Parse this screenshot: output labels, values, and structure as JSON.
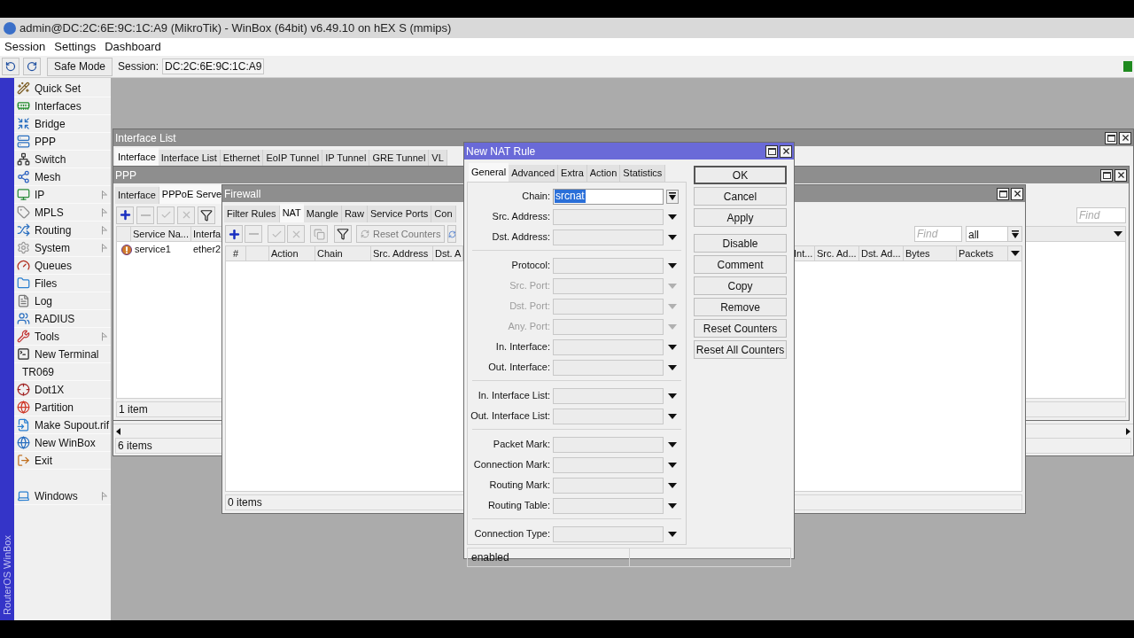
{
  "app": {
    "title": "admin@DC:2C:6E:9C:1C:A9 (MikroTik) - WinBox (64bit) v6.49.10 on hEX S (mmips)",
    "menu": [
      "Session",
      "Settings",
      "Dashboard"
    ],
    "safe_mode": "Safe Mode",
    "session_label": "Session:",
    "session_value": "DC:2C:6E:9C:1C:A9",
    "side_label": "RouterOS WinBox"
  },
  "sidebar": {
    "groups": [
      [
        {
          "label": "Quick Set",
          "submenu": false
        },
        {
          "label": "Interfaces",
          "submenu": false
        },
        {
          "label": "Bridge",
          "submenu": false
        },
        {
          "label": "PPP",
          "submenu": false
        },
        {
          "label": "Switch",
          "submenu": false
        },
        {
          "label": "Mesh",
          "submenu": false
        },
        {
          "label": "IP",
          "submenu": true
        },
        {
          "label": "MPLS",
          "submenu": true
        },
        {
          "label": "Routing",
          "submenu": true
        },
        {
          "label": "System",
          "submenu": true
        },
        {
          "label": "Queues",
          "submenu": false
        },
        {
          "label": "Files",
          "submenu": false
        },
        {
          "label": "Log",
          "submenu": false
        },
        {
          "label": "RADIUS",
          "submenu": false
        },
        {
          "label": "Tools",
          "submenu": true
        },
        {
          "label": "New Terminal",
          "submenu": false
        },
        {
          "label": "TR069",
          "submenu": false
        },
        {
          "label": "Dot1X",
          "submenu": false
        },
        {
          "label": "Partition",
          "submenu": false
        },
        {
          "label": "Make Supout.rif",
          "submenu": false
        },
        {
          "label": "New WinBox",
          "submenu": false
        },
        {
          "label": "Exit",
          "submenu": false
        }
      ],
      [
        {
          "label": "Windows",
          "submenu": true
        }
      ]
    ]
  },
  "interface_list_window": {
    "title": "Interface List",
    "tabs": [
      {
        "label": "Interface",
        "selected": true
      },
      {
        "label": "Interface List",
        "selected": false
      },
      {
        "label": "Ethernet",
        "selected": false
      },
      {
        "label": "EoIP Tunnel",
        "selected": false
      },
      {
        "label": "IP Tunnel",
        "selected": false
      },
      {
        "label": "GRE Tunnel",
        "selected": false
      },
      {
        "label": "VL",
        "selected": false
      }
    ],
    "status": "6 items"
  },
  "ppp_window": {
    "title": "PPP",
    "tabs": [
      {
        "label": "Interface",
        "selected": false
      },
      {
        "label": "PPPoE Serve",
        "selected": true
      }
    ],
    "find_placeholder": "Find",
    "columns": [
      "Service Na...",
      "Interfa"
    ],
    "rows": [
      {
        "cells": [
          "service1",
          "ether2"
        ]
      }
    ],
    "status": "1 item"
  },
  "firewall_window": {
    "title": "Firewall",
    "tabs": [
      {
        "label": "Filter Rules",
        "selected": false
      },
      {
        "label": "NAT",
        "selected": true
      },
      {
        "label": "Mangle",
        "selected": false
      },
      {
        "label": "Raw",
        "selected": false
      },
      {
        "label": "Service Ports",
        "selected": false
      },
      {
        "label": "Con",
        "selected": false
      }
    ],
    "reset_counters": "Reset Counters",
    "find_placeholder": "Find",
    "filter_value": "all",
    "columns_left": [
      "#",
      "Action",
      "Chain",
      "Src. Address",
      "Dst. A"
    ],
    "columns_right": [
      "Int...",
      "Src. Ad...",
      "Dst. Ad...",
      "Bytes",
      "Packets"
    ],
    "status": "0 items"
  },
  "nat_rule_dialog": {
    "title": "New NAT Rule",
    "tabs": [
      {
        "label": "General",
        "selected": true
      },
      {
        "label": "Advanced",
        "selected": false
      },
      {
        "label": "Extra",
        "selected": false
      },
      {
        "label": "Action",
        "selected": false
      },
      {
        "label": "Statistics",
        "selected": false
      }
    ],
    "sections": [
      [
        {
          "label": "Chain:",
          "kind": "combo",
          "value": "srcnat",
          "highlighted": true,
          "disabled": false
        },
        {
          "label": "Src. Address:",
          "kind": "dropdown",
          "disabled": false
        },
        {
          "label": "Dst. Address:",
          "kind": "dropdown",
          "disabled": false
        }
      ],
      [
        {
          "label": "Protocol:",
          "kind": "dropdown",
          "disabled": false
        },
        {
          "label": "Src. Port:",
          "kind": "dropdown",
          "disabled": true
        },
        {
          "label": "Dst. Port:",
          "kind": "dropdown",
          "disabled": true
        },
        {
          "label": "Any. Port:",
          "kind": "dropdown",
          "disabled": true
        },
        {
          "label": "In. Interface:",
          "kind": "dropdown",
          "disabled": false
        },
        {
          "label": "Out. Interface:",
          "kind": "dropdown",
          "disabled": false
        }
      ],
      [
        {
          "label": "In. Interface List:",
          "kind": "dropdown",
          "disabled": false
        },
        {
          "label": "Out. Interface List:",
          "kind": "dropdown",
          "disabled": false
        }
      ],
      [
        {
          "label": "Packet Mark:",
          "kind": "dropdown",
          "disabled": false
        },
        {
          "label": "Connection Mark:",
          "kind": "dropdown",
          "disabled": false
        },
        {
          "label": "Routing Mark:",
          "kind": "dropdown",
          "disabled": false
        },
        {
          "label": "Routing Table:",
          "kind": "dropdown",
          "disabled": false
        }
      ],
      [
        {
          "label": "Connection Type:",
          "kind": "dropdown",
          "disabled": false
        }
      ]
    ],
    "button_groups": [
      [
        {
          "label": "OK",
          "default": true
        },
        {
          "label": "Cancel",
          "default": false
        },
        {
          "label": "Apply",
          "default": false
        }
      ],
      [
        {
          "label": "Disable",
          "default": false
        },
        {
          "label": "Comment",
          "default": false
        },
        {
          "label": "Copy",
          "default": false
        },
        {
          "label": "Remove",
          "default": false
        },
        {
          "label": "Reset Counters",
          "default": false
        },
        {
          "label": "Reset All Counters",
          "default": false
        }
      ]
    ],
    "status": "enabled"
  }
}
